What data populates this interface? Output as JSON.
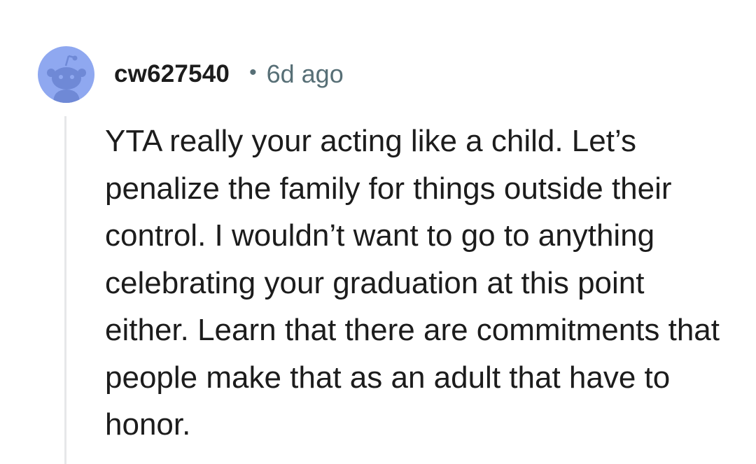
{
  "comment": {
    "username": "cw627540",
    "separator": "•",
    "timestamp": "6d ago",
    "avatar_icon": "reddit-snoo-avatar-icon",
    "avatar_color": "#8fa8f0",
    "text": "YTA really your acting like a child. Let’s penalize the family for things outside their control. I wouldn’t want to go to anything celebrating your graduation at this point either. Learn that there are commitments that people make that as an adult that have to honor."
  }
}
